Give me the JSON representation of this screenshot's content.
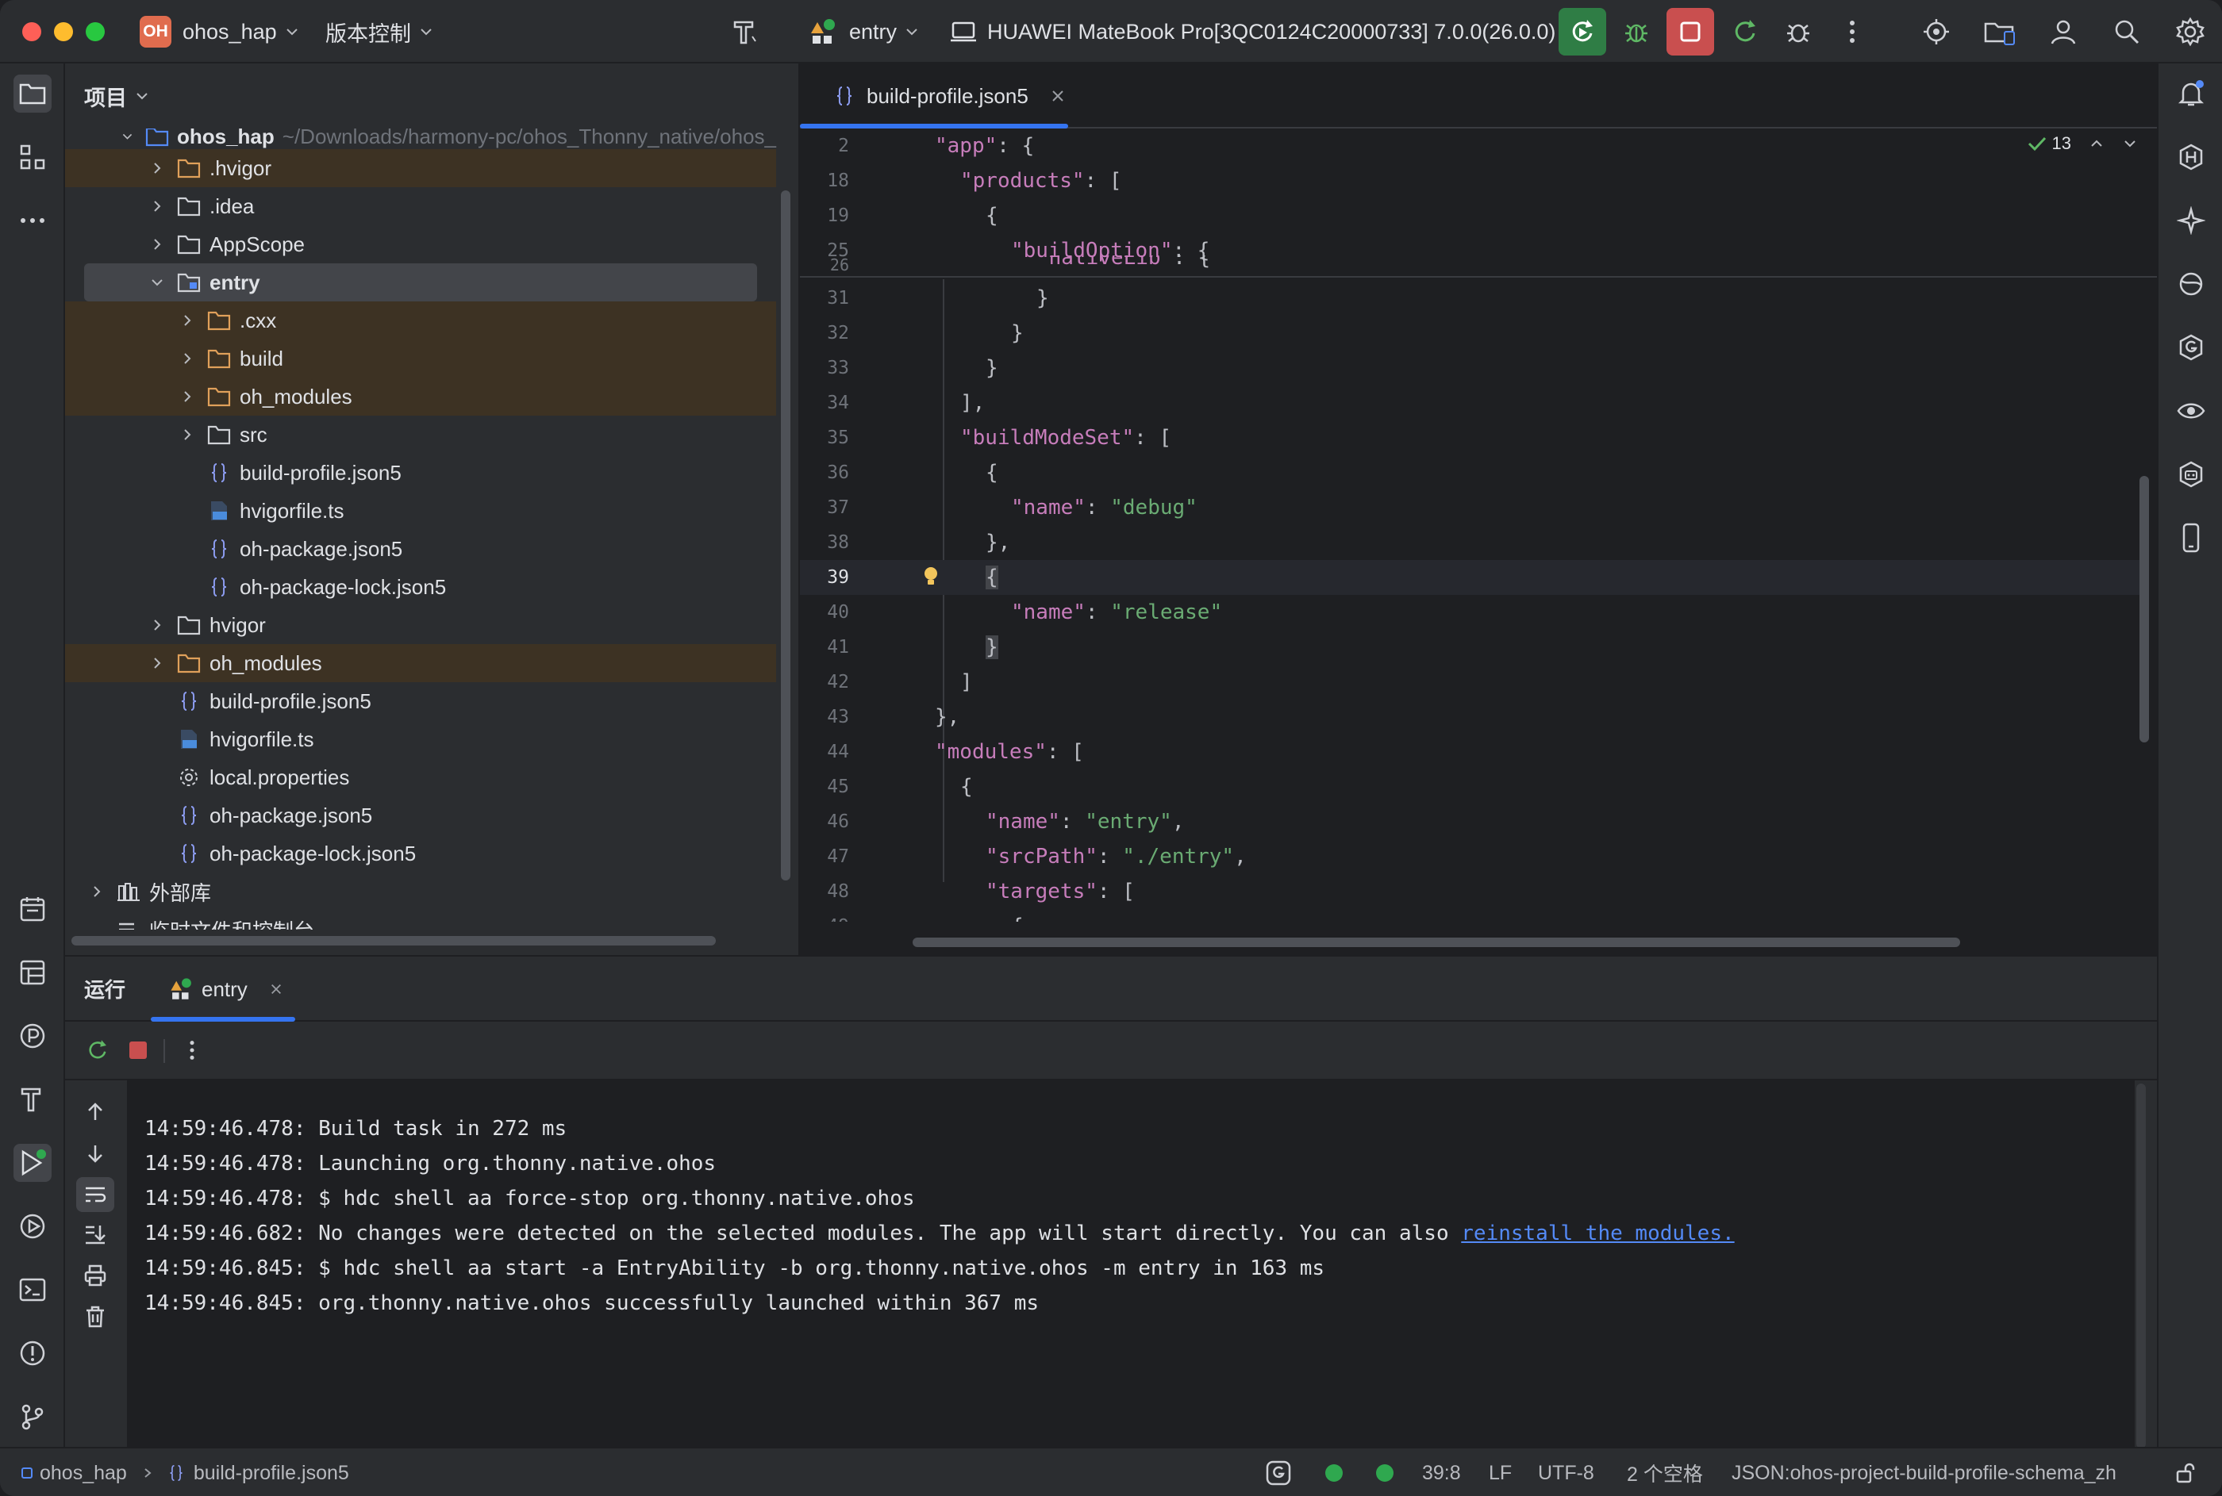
{
  "titlebar": {
    "project_badge": "OH",
    "project_name": "ohos_hap",
    "vcs_label": "版本控制",
    "run_config": "entry",
    "device": "HUAWEI MateBook Pro[3QC0124C20000733] 7.0.0(26.0.0)"
  },
  "project_panel": {
    "title": "项目",
    "root": {
      "name": "ohos_hap",
      "path": "~/Downloads/harmony-pc/ohos_Thonny_native/ohos_"
    },
    "items": [
      {
        "label": ".hvigor",
        "type": "folder"
      },
      {
        "label": ".idea",
        "type": "folder"
      },
      {
        "label": "AppScope",
        "type": "folder"
      },
      {
        "label": "entry",
        "type": "module"
      },
      {
        "label": ".cxx",
        "type": "folder"
      },
      {
        "label": "build",
        "type": "folder"
      },
      {
        "label": "oh_modules",
        "type": "folder"
      },
      {
        "label": "src",
        "type": "folder"
      },
      {
        "label": "build-profile.json5",
        "type": "json"
      },
      {
        "label": "hvigorfile.ts",
        "type": "ts"
      },
      {
        "label": "oh-package.json5",
        "type": "json"
      },
      {
        "label": "oh-package-lock.json5",
        "type": "json"
      },
      {
        "label": "hvigor",
        "type": "folder"
      },
      {
        "label": "oh_modules",
        "type": "folder"
      },
      {
        "label": "build-profile.json5",
        "type": "json"
      },
      {
        "label": "hvigorfile.ts",
        "type": "ts"
      },
      {
        "label": "local.properties",
        "type": "properties"
      },
      {
        "label": "oh-package.json5",
        "type": "json"
      },
      {
        "label": "oh-package-lock.json5",
        "type": "json"
      },
      {
        "label": "外部库",
        "type": "library"
      },
      {
        "label": "临时文件和控制台",
        "type": "scratch"
      }
    ]
  },
  "editor": {
    "tab_label": "build-profile.json5",
    "inspection_count": "13",
    "lines": [
      {
        "num": "2",
        "text": "\"app\": {"
      },
      {
        "num": "18",
        "text": "\"products\": ["
      },
      {
        "num": "19",
        "text": "{"
      },
      {
        "num": "25",
        "text": "\"buildOption\": {"
      },
      {
        "num": "26",
        "text": "\"nativeLib\": {"
      },
      {
        "num": "31",
        "text": "}"
      },
      {
        "num": "32",
        "text": "}"
      },
      {
        "num": "33",
        "text": "}"
      },
      {
        "num": "34",
        "text": "],"
      },
      {
        "num": "35",
        "text": "\"buildModeSet\": ["
      },
      {
        "num": "36",
        "text": "{"
      },
      {
        "num": "37",
        "text": "\"name\": \"debug\""
      },
      {
        "num": "38",
        "text": "},"
      },
      {
        "num": "39",
        "text": "{"
      },
      {
        "num": "40",
        "text": "\"name\": \"release\""
      },
      {
        "num": "41",
        "text": "}"
      },
      {
        "num": "42",
        "text": "]"
      },
      {
        "num": "43",
        "text": "},"
      },
      {
        "num": "44",
        "text": "\"modules\": ["
      },
      {
        "num": "45",
        "text": "{"
      },
      {
        "num": "46",
        "text": "\"name\": \"entry\","
      },
      {
        "num": "47",
        "text": "\"srcPath\": \"./entry\","
      },
      {
        "num": "48",
        "text": "\"targets\": ["
      },
      {
        "num": "49",
        "text": "{"
      }
    ]
  },
  "run_panel": {
    "title": "运行",
    "tab_label": "entry",
    "console": [
      {
        "text": "14:59:46.478: Build task in 272 ms"
      },
      {
        "text": "14:59:46.478: Launching org.thonny.native.ohos"
      },
      {
        "text": "14:59:46.478: $ hdc shell aa force-stop org.thonny.native.ohos"
      },
      {
        "text": "14:59:46.682: No changes were detected on the selected modules. The app will start directly. You can also ",
        "link": "reinstall the modules."
      },
      {
        "text": "14:59:46.845: $ hdc shell aa start -a EntryAbility -b org.thonny.native.ohos -m entry in 163 ms"
      },
      {
        "text": "14:59:46.845: org.thonny.native.ohos successfully launched within 367 ms"
      }
    ]
  },
  "statusbar": {
    "breadcrumb_project": "ohos_hap",
    "breadcrumb_file": "build-profile.json5",
    "cursor": "39:8",
    "line_ending": "LF",
    "encoding": "UTF-8",
    "indent": "2 个空格",
    "schema": "JSON:ohos-project-build-profile-schema_zh"
  },
  "colors": {
    "accent": "#3574f0",
    "excluded_bg": "#3d3223",
    "run_green": "#2fa84f",
    "stop_red": "#d24d4d"
  }
}
